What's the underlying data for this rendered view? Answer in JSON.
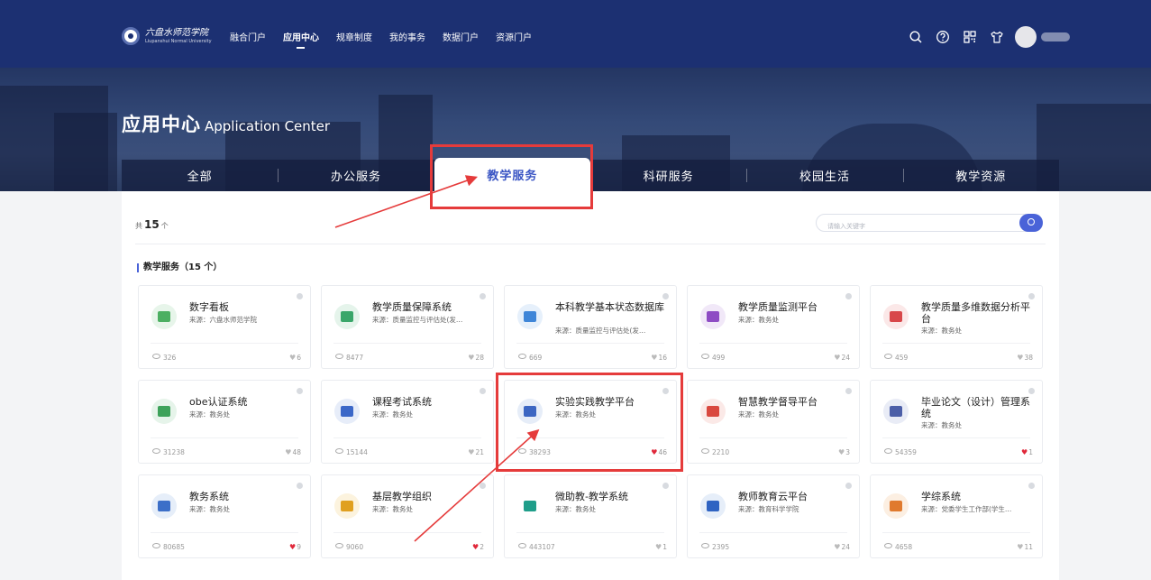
{
  "header": {
    "logo": {
      "cn": "六盘水师范学院",
      "en": "Liupanshui Normal University"
    },
    "nav": [
      {
        "label": "融合门户",
        "active": false
      },
      {
        "label": "应用中心",
        "active": true
      },
      {
        "label": "规章制度",
        "active": false
      },
      {
        "label": "我的事务",
        "active": false
      },
      {
        "label": "数据门户",
        "active": false
      },
      {
        "label": "资源门户",
        "active": false
      }
    ],
    "tools": [
      "search-icon",
      "help-icon",
      "qrcode-icon",
      "shirt-icon"
    ]
  },
  "banner": {
    "title_cn": "应用中心",
    "title_en": "Application Center"
  },
  "tabs": [
    {
      "label": "全部",
      "active": false
    },
    {
      "label": "办公服务",
      "active": false
    },
    {
      "label": "教学服务",
      "active": true
    },
    {
      "label": "科研服务",
      "active": false
    },
    {
      "label": "校园生活",
      "active": false
    },
    {
      "label": "教学资源",
      "active": false
    }
  ],
  "toolbar": {
    "total_prefix": "共",
    "total_count": "15",
    "total_suffix": "个",
    "search_placeholder": "请输入关键字"
  },
  "section_title": "教学服务（15 个）",
  "apps": [
    {
      "name": "数字看板",
      "source": "来源：六盘水师范学院",
      "views": "326",
      "likes": "6",
      "liked": false,
      "icon": "dashboard-icon",
      "color": "#4caf62",
      "bg": "#e7f5ea"
    },
    {
      "name": "教学质量保障系统",
      "source": "来源：质量监控与评估处(发…",
      "views": "8477",
      "likes": "28",
      "liked": false,
      "icon": "quality-assurance-icon",
      "color": "#3aa66a",
      "bg": "#e5f4eb"
    },
    {
      "name": "本科教学基本状态数据库",
      "source": "来源：质量监控与评估处(发…",
      "views": "669",
      "likes": "16",
      "liked": false,
      "icon": "database-icon",
      "color": "#3f86d8",
      "bg": "#e6f0fb"
    },
    {
      "name": "教学质量监测平台",
      "source": "来源：教务处",
      "views": "499",
      "likes": "24",
      "liked": false,
      "icon": "monitor-board-icon",
      "color": "#8e4cc4",
      "bg": "#f1e8f8"
    },
    {
      "name": "教学质量多维数据分析平台",
      "source": "来源：教务处",
      "views": "459",
      "likes": "38",
      "liked": false,
      "icon": "analysis-icon",
      "color": "#d8474a",
      "bg": "#fbe8e8"
    },
    {
      "name": "obe认证系统",
      "source": "来源：教务处",
      "views": "31238",
      "likes": "48",
      "liked": false,
      "icon": "certificate-icon",
      "color": "#3da25a",
      "bg": "#e6f4ea"
    },
    {
      "name": "课程考试系统",
      "source": "来源：教务处",
      "views": "15144",
      "likes": "21",
      "liked": false,
      "icon": "exam-icon",
      "color": "#3c68c8",
      "bg": "#e7edf9"
    },
    {
      "name": "实验实践教学平台",
      "source": "来源：教务处",
      "views": "38293",
      "likes": "46",
      "liked": true,
      "icon": "lab-calendar-icon",
      "color": "#3c66c2",
      "bg": "#e6edf8"
    },
    {
      "name": "智慧教学督导平台",
      "source": "来源：教务处",
      "views": "2210",
      "likes": "3",
      "liked": false,
      "icon": "supervision-icon",
      "color": "#d9483f",
      "bg": "#fbe9e7"
    },
    {
      "name": "毕业论文（设计）管理系统",
      "source": "来源：教务处",
      "views": "54359",
      "likes": "1",
      "liked": true,
      "icon": "thesis-icon",
      "color": "#4c5fa8",
      "bg": "#e9ecf6"
    },
    {
      "name": "教务系统",
      "source": "来源：教务处",
      "views": "80685",
      "likes": "9",
      "liked": true,
      "icon": "books-icon",
      "color": "#3c6fc8",
      "bg": "#e6eef9"
    },
    {
      "name": "基层教学组织",
      "source": "来源：教务处",
      "views": "9060",
      "likes": "2",
      "liked": true,
      "icon": "layers-icon",
      "color": "#e0a020",
      "bg": "#fcf3de"
    },
    {
      "name": "微助教-教学系统",
      "source": "来源：教务处",
      "views": "443107",
      "likes": "1",
      "liked": false,
      "icon": "graduation-cap-icon",
      "color": "#1f9e8a",
      "bg": "#ffffff"
    },
    {
      "name": "教师教育云平台",
      "source": "来源：教育科学学院",
      "views": "2395",
      "likes": "24",
      "liked": false,
      "icon": "video-screen-icon",
      "color": "#2f63c2",
      "bg": "#e6eef9"
    },
    {
      "name": "学综系统",
      "source": "来源：党委学生工作部(学生…",
      "views": "4658",
      "likes": "11",
      "liked": false,
      "icon": "presentation-icon",
      "color": "#e07a2e",
      "bg": "#fcefe2"
    }
  ]
}
